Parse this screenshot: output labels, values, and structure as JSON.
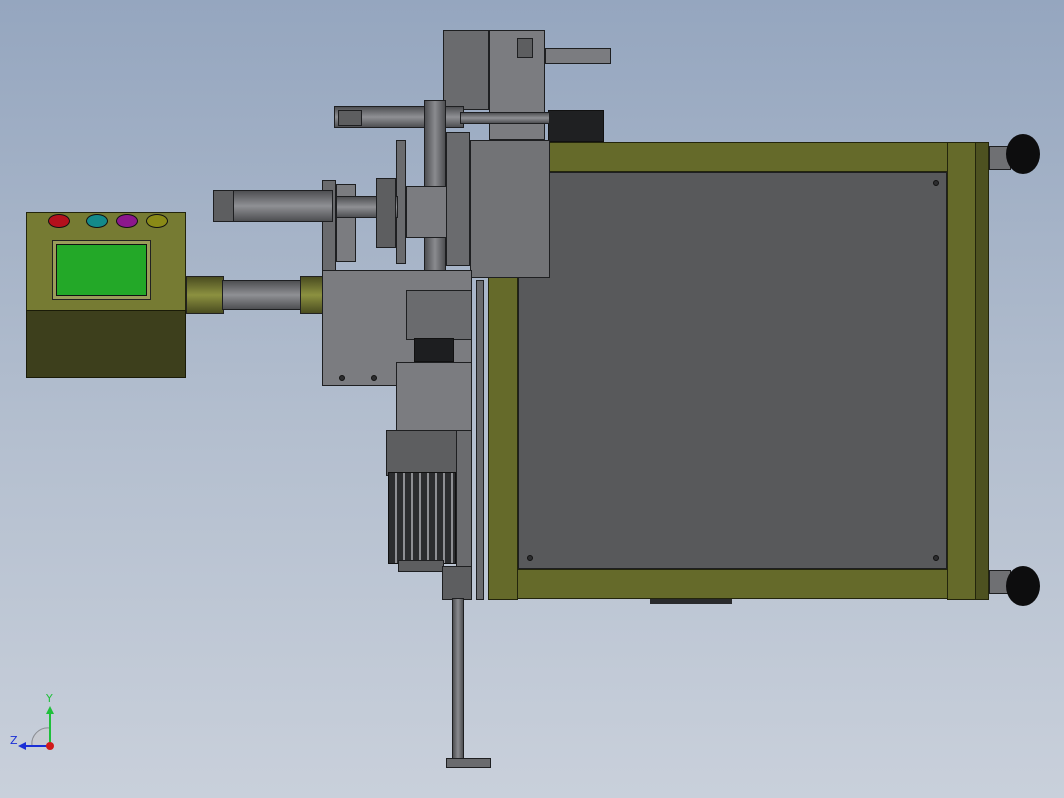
{
  "viewport": {
    "background": "#a9b5c8"
  },
  "control_box": {
    "buttons": [
      {
        "name": "red-button",
        "color": "#b4101c"
      },
      {
        "name": "teal-button",
        "color": "#138a8a"
      },
      {
        "name": "purple-button",
        "color": "#8c178c"
      },
      {
        "name": "olive-button",
        "color": "#8a8a16"
      }
    ],
    "screen_color": "#23a828",
    "body_color": "#767b33"
  },
  "frame": {
    "color": "#656a2a",
    "panel_color": "#58595b"
  },
  "axis_triad": {
    "x_label": "",
    "y_label": "Y",
    "z_label": "Z",
    "y_color": "#1fbf3a",
    "z_color": "#1a2fd6",
    "x_color": "#d11a1a"
  }
}
